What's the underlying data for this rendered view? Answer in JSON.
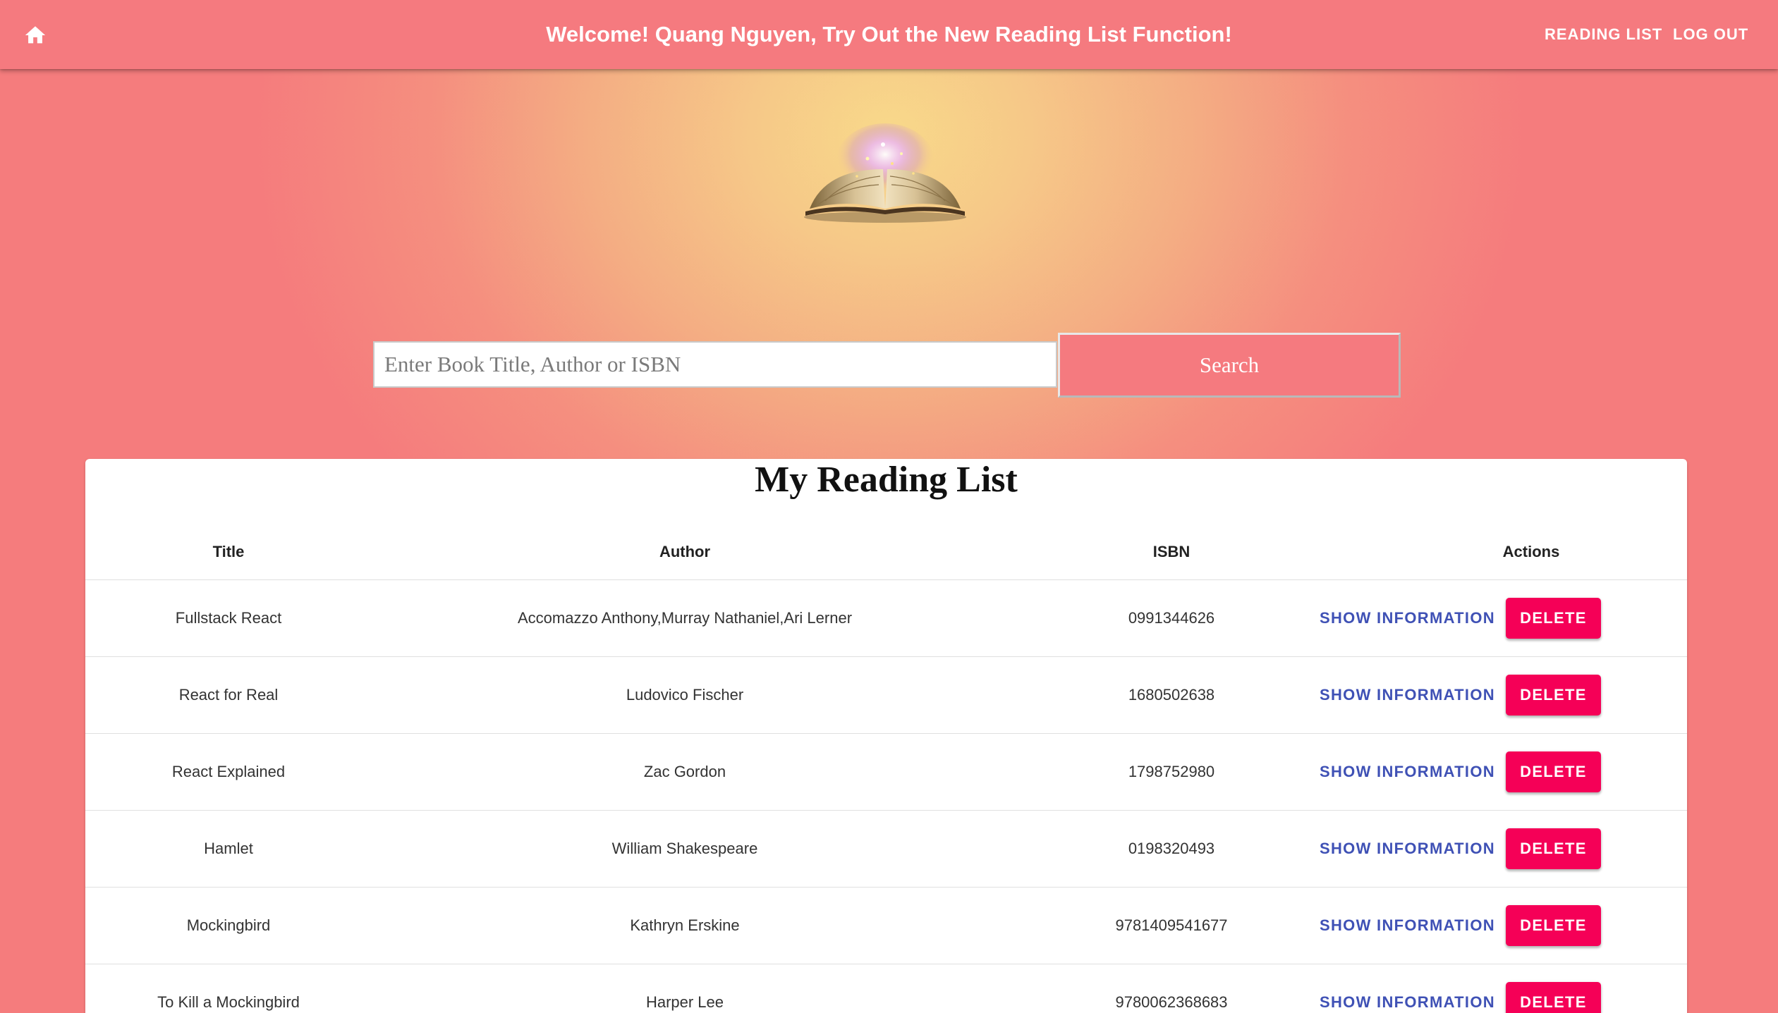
{
  "appbar": {
    "title": "Welcome! Quang Nguyen, Try Out the New Reading List Function!",
    "home_icon": "home-icon",
    "nav": [
      {
        "label": "READING LIST"
      },
      {
        "label": "LOG OUT"
      }
    ]
  },
  "logo": {
    "icon": "open-book-icon"
  },
  "search": {
    "placeholder": "Enter Book Title, Author or ISBN",
    "button_label": "Search"
  },
  "reading_list": {
    "title": "My Reading List",
    "columns": [
      "Title",
      "Author",
      "ISBN",
      "Actions"
    ],
    "rows": [
      {
        "title": "Fullstack React",
        "author": "Accomazzo Anthony,Murray Nathaniel,Ari Lerner",
        "isbn": "0991344626"
      },
      {
        "title": "React for Real",
        "author": "Ludovico Fischer",
        "isbn": "1680502638"
      },
      {
        "title": "React Explained",
        "author": "Zac Gordon",
        "isbn": "1798752980"
      },
      {
        "title": "Hamlet",
        "author": "William Shakespeare",
        "isbn": "0198320493"
      },
      {
        "title": "Mockingbird",
        "author": "Kathryn Erskine",
        "isbn": "9781409541677"
      },
      {
        "title": "To Kill a Mockingbird",
        "author": "Harper Lee",
        "isbn": "9780062368683"
      }
    ],
    "show_label": "SHOW INFORMATION",
    "delete_label": "DELETE"
  },
  "colors": {
    "appbar": "#f57a7f",
    "accent_primary": "#3f51b5",
    "accent_secondary": "#f50057"
  }
}
